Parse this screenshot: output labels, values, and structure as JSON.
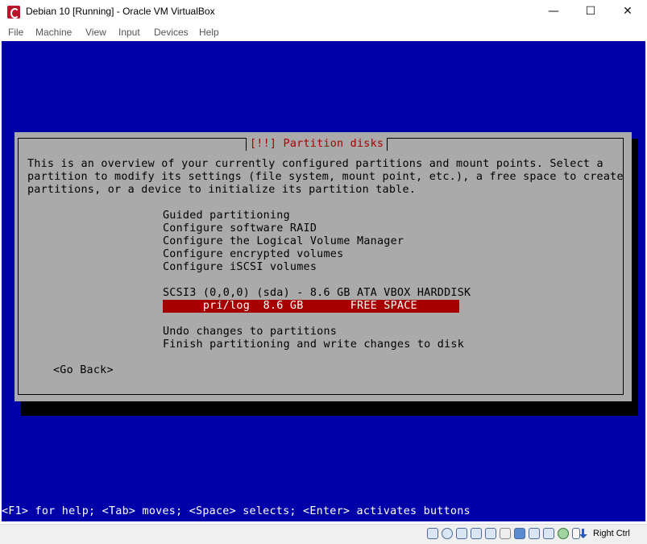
{
  "window": {
    "title": "Debian 10 [Running] - Oracle VM VirtualBox",
    "minimize_glyph": "—",
    "maximize_glyph": "☐",
    "close_glyph": "✕"
  },
  "menu": [
    "File",
    "Machine",
    "View",
    "Input",
    "Devices",
    "Help"
  ],
  "dialog": {
    "title": "[!!] Partition disks",
    "intro": [
      "This is an overview of your currently configured partitions and mount points. Select a",
      "partition to modify its settings (file system, mount point, etc.), a free space to create",
      "partitions, or a device to initialize its partition table."
    ],
    "options": [
      "Guided partitioning",
      "Configure software RAID",
      "Configure the Logical Volume Manager",
      "Configure encrypted volumes",
      "Configure iSCSI volumes"
    ],
    "disk": "SCSI3 (0,0,0) (sda) - 8.6 GB ATA VBOX HARDDISK",
    "selected_partition": "      pri/log  8.6 GB       FREE SPACE",
    "actions": [
      "Undo changes to partitions",
      "Finish partitioning and write changes to disk"
    ],
    "go_back": "<Go Back>"
  },
  "help_line": "<F1> for help; <Tab> moves; <Space> selects; <Enter> activates buttons",
  "status_bar": {
    "icons": [
      "hard-disk-icon",
      "optical-drive-icon",
      "audio-icon",
      "network-icon",
      "usb-icon",
      "shared-folders-icon",
      "display-icon",
      "video-capture-icon",
      "cpu-icon",
      "guest-additions-icon",
      "mouse-integration-icon"
    ],
    "host_key": "Right Ctrl"
  },
  "colors": {
    "screen_bg": "#0000a8",
    "dialog_bg": "#aaaaaa",
    "highlight": "#a80000",
    "title_text": "#a80000"
  }
}
